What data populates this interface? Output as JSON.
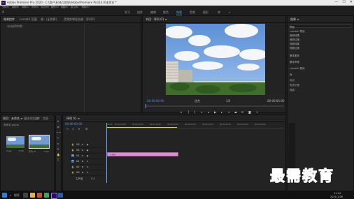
{
  "window": {
    "title": "Adobe Premiere Pro 2020 - C:\\用户\\Eddy\\文档\\Adobe\\Premiere Pro\\14.0\\未命名 *",
    "app_icon": "Pr",
    "controls": [
      "—",
      "☐",
      "✕"
    ]
  },
  "menu": [
    "文件(F)",
    "编辑(E)",
    "剪辑(C)",
    "序列(S)",
    "标记(M)",
    "图形(G)",
    "视图(V)",
    "窗口(W)",
    "帮助(H)"
  ],
  "workspaces": {
    "tabs": [
      "学习",
      "组件",
      "编辑",
      "颜色",
      "效果",
      "音频",
      "图形",
      "库"
    ],
    "active_index": 4,
    "more": "»"
  },
  "source_panel": {
    "tabs": [
      "效果控件",
      "Lumetri 范围",
      "源：(无剪辑)",
      "音频剪辑混合器：序列01"
    ],
    "no_clip": "（未选择剪辑）"
  },
  "program_monitor": {
    "title": "节目：序列 01 ≡",
    "timecode_left": "00:00:00:00",
    "fit": "适合",
    "quality": "1/2",
    "timecode_right": "00:00:05:00"
  },
  "project_panel": {
    "tabs": [
      "项目：未命名 ≡",
      "媒体浏览器",
      "库",
      "信息"
    ],
    "file": "未命名.prproj",
    "items": [
      {
        "name": "2.jpg",
        "duration": "5:00"
      },
      {
        "name": "序列 01",
        "duration": "5:00"
      }
    ]
  },
  "timeline": {
    "title": "序列 01 ≡",
    "timecode": "00:00:00:00",
    "ruler": [
      "00:00",
      "00:00:05:00",
      "00:00:10:00",
      "00:00:15:00",
      "00:00:20:00",
      "00:00:25:00",
      "00:00:30:00",
      "00:00:35:00",
      "00:00:40:00",
      "00:00:45:00"
    ],
    "video_tracks": [
      "V3",
      "V2",
      "V1"
    ],
    "audio_tracks": [
      "A1",
      "A2",
      "A3"
    ],
    "clip_label": "2.jpg",
    "master": "主声道",
    "master_value": "0.0"
  },
  "effects_panel": {
    "title": "效果 ≡",
    "tree": [
      "预设",
      "Lumetri 预设",
      "音频效果",
      "音频过渡",
      "视频效果",
      "视频过渡"
    ],
    "sections": [
      "基本图形",
      "基本声音",
      "Lumetri 颜色",
      "库",
      "标记",
      "历史记录",
      "信息"
    ]
  },
  "taskbar": {
    "time": "11:24",
    "date": "2021/1/26",
    "search": "搜索"
  },
  "watermark": "最需教育",
  "colors": {
    "accent": "#5aa0ff",
    "clip": "#e38ad8",
    "timecode": "#4e8fe6",
    "watermark": "#2c1fd0"
  }
}
